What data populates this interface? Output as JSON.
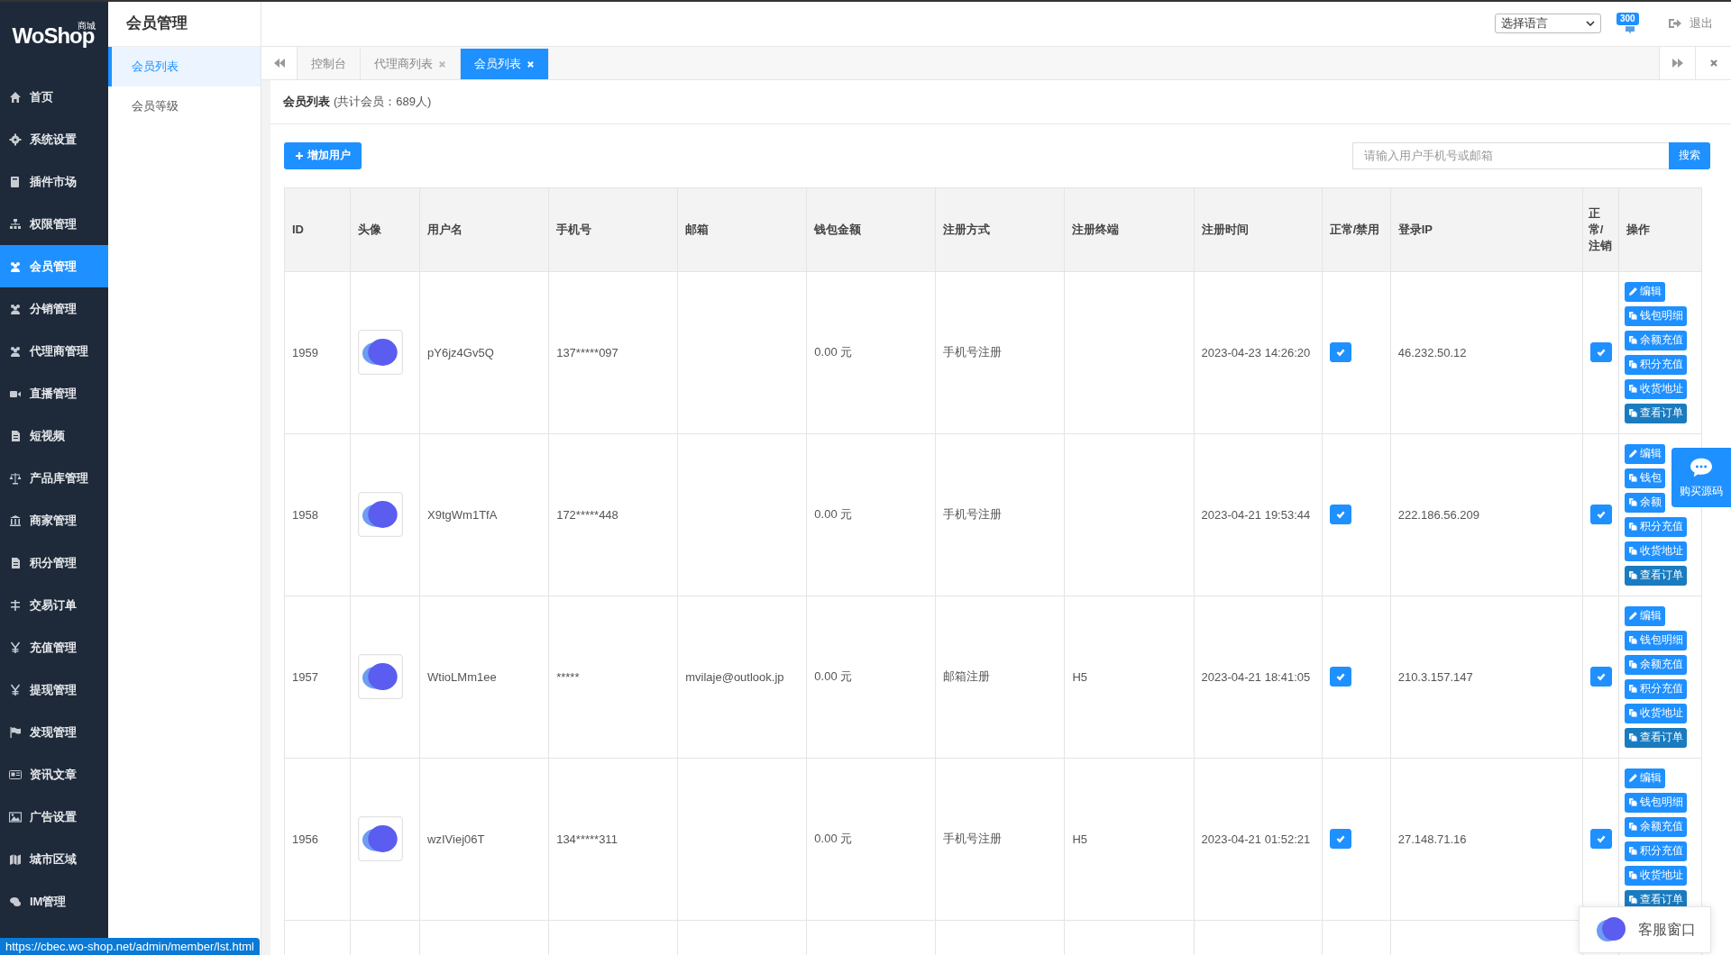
{
  "logo": {
    "text": "WoShop",
    "tag": "商城"
  },
  "sidebar": {
    "items": [
      {
        "label": "首页",
        "selected": false
      },
      {
        "label": "系统设置",
        "selected": false
      },
      {
        "label": "插件市场",
        "selected": false
      },
      {
        "label": "权限管理",
        "selected": false
      },
      {
        "label": "会员管理",
        "selected": true
      },
      {
        "label": "分销管理",
        "selected": false
      },
      {
        "label": "代理商管理",
        "selected": false
      },
      {
        "label": "直播管理",
        "selected": false
      },
      {
        "label": "短视频",
        "selected": false
      },
      {
        "label": "产品库管理",
        "selected": false
      },
      {
        "label": "商家管理",
        "selected": false
      },
      {
        "label": "积分管理",
        "selected": false
      },
      {
        "label": "交易订单",
        "selected": false
      },
      {
        "label": "充值管理",
        "selected": false
      },
      {
        "label": "提现管理",
        "selected": false
      },
      {
        "label": "发现管理",
        "selected": false
      },
      {
        "label": "资讯文章",
        "selected": false
      },
      {
        "label": "广告设置",
        "selected": false
      },
      {
        "label": "城市区域",
        "selected": false
      },
      {
        "label": "IM管理",
        "selected": false
      }
    ]
  },
  "submenu": {
    "title": "会员管理",
    "items": [
      {
        "label": "会员列表",
        "selected": true
      },
      {
        "label": "会员等级",
        "selected": false
      }
    ]
  },
  "topbar": {
    "language_select": "选择语言",
    "notification_count": "300",
    "logout": "退出"
  },
  "tabs": [
    {
      "label": "控制台",
      "closable": false,
      "selected": false
    },
    {
      "label": "代理商列表",
      "closable": true,
      "selected": false
    },
    {
      "label": "会员列表",
      "closable": true,
      "selected": true
    }
  ],
  "panel": {
    "title": "会员列表",
    "subtitle": "(共计会员：689人)",
    "add_button": "增加用户",
    "search": {
      "placeholder": "请输入用户手机号或邮箱",
      "button": "搜索"
    }
  },
  "table": {
    "columns": [
      "ID",
      "头像",
      "用户名",
      "手机号",
      "邮箱",
      "钱包金额",
      "注册方式",
      "注册终端",
      "注册时间",
      "正常/禁用",
      "登录IP",
      "正常/注销",
      "操作"
    ],
    "rows": [
      {
        "id": "1959",
        "username": "pY6jz4Gv5Q",
        "phone": "137*****097",
        "email": "",
        "wallet": "0.00 元",
        "method": "手机号注册",
        "terminal": "",
        "time": "2023-04-23 14:26:20",
        "enabled": true,
        "ip": "46.232.50.12",
        "active": true,
        "actions": [
          {
            "kind": "edit",
            "label": "编辑"
          },
          {
            "kind": "doc",
            "label": "钱包明细"
          },
          {
            "kind": "doc",
            "label": "余额充值"
          },
          {
            "kind": "doc",
            "label": "积分充值"
          },
          {
            "kind": "doc",
            "label": "收货地址"
          },
          {
            "kind": "order",
            "label": "查看订单"
          }
        ]
      },
      {
        "id": "1958",
        "username": "X9tgWm1TfA",
        "phone": "172*****448",
        "email": "",
        "wallet": "0.00 元",
        "method": "手机号注册",
        "terminal": "",
        "time": "2023-04-21 19:53:44",
        "enabled": true,
        "ip": "222.186.56.209",
        "active": true,
        "actions": [
          {
            "kind": "edit",
            "label": "编辑"
          },
          {
            "kind": "doc",
            "label": "钱包"
          },
          {
            "kind": "doc",
            "label": "余额"
          },
          {
            "kind": "doc",
            "label": "积分充值"
          },
          {
            "kind": "doc",
            "label": "收货地址"
          },
          {
            "kind": "order",
            "label": "查看订单"
          }
        ]
      },
      {
        "id": "1957",
        "username": "WtioLMm1ee",
        "phone": "*****",
        "email": "mvilaje@outlook.jp",
        "wallet": "0.00 元",
        "method": "邮箱注册",
        "terminal": "H5",
        "time": "2023-04-21 18:41:05",
        "enabled": true,
        "ip": "210.3.157.147",
        "active": true,
        "actions": [
          {
            "kind": "edit",
            "label": "编辑"
          },
          {
            "kind": "doc",
            "label": "钱包明细"
          },
          {
            "kind": "doc",
            "label": "余额充值"
          },
          {
            "kind": "doc",
            "label": "积分充值"
          },
          {
            "kind": "doc",
            "label": "收货地址"
          },
          {
            "kind": "order",
            "label": "查看订单"
          }
        ]
      },
      {
        "id": "1956",
        "username": "wzIViej06T",
        "phone": "134*****311",
        "email": "",
        "wallet": "0.00 元",
        "method": "手机号注册",
        "terminal": "H5",
        "time": "2023-04-21 01:52:21",
        "enabled": true,
        "ip": "27.148.71.16",
        "active": true,
        "actions": [
          {
            "kind": "edit",
            "label": "编辑"
          },
          {
            "kind": "doc",
            "label": "钱包明细"
          },
          {
            "kind": "doc",
            "label": "余额充值"
          },
          {
            "kind": "doc",
            "label": "积分充值"
          },
          {
            "kind": "doc",
            "label": "收货地址"
          },
          {
            "kind": "order",
            "label": "查看订单"
          }
        ]
      }
    ]
  },
  "float_widget": {
    "label": "购买源码"
  },
  "chat_popup": {
    "label": "客服窗口"
  },
  "status_url": "https://cbec.wo-shop.net/admin/member/lst.html"
}
